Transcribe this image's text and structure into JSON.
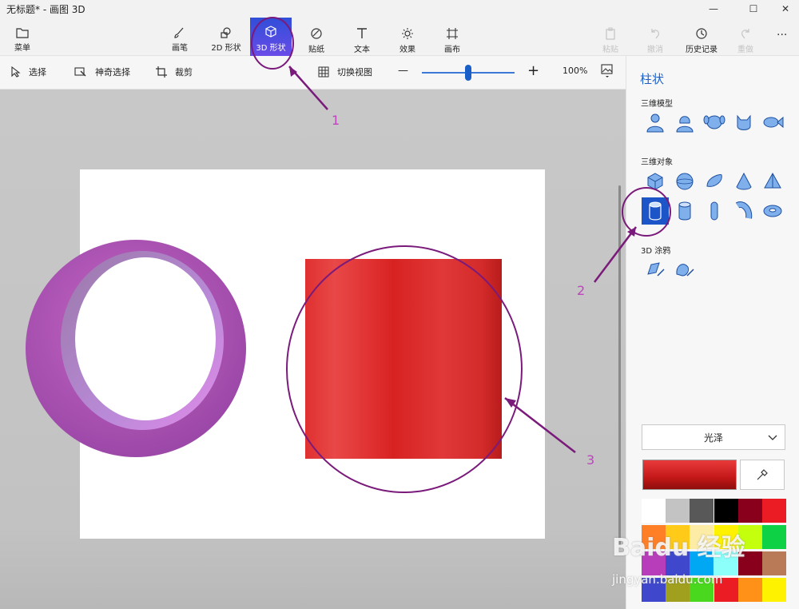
{
  "window": {
    "title": "无标题* - 画图 3D",
    "controls": [
      "—",
      "☐",
      "✕"
    ]
  },
  "ribbon": {
    "menu": "菜单",
    "tools": [
      {
        "label": "画笔",
        "icon": "brush-icon"
      },
      {
        "label": "2D 形状",
        "icon": "shapes-2d-icon"
      },
      {
        "label": "3D 形状",
        "icon": "cube-icon"
      },
      {
        "label": "贴纸",
        "icon": "sticker-icon"
      },
      {
        "label": "文本",
        "icon": "text-icon"
      },
      {
        "label": "效果",
        "icon": "effects-icon"
      },
      {
        "label": "画布",
        "icon": "canvas-icon"
      }
    ],
    "active_tool": "3D 形状",
    "right_actions": [
      {
        "label": "粘贴",
        "icon": "paste-icon",
        "enabled": false
      },
      {
        "label": "撤消",
        "icon": "undo-icon",
        "enabled": false
      },
      {
        "label": "历史记录",
        "icon": "history-icon",
        "enabled": true
      },
      {
        "label": "重做",
        "icon": "redo-icon",
        "enabled": false
      }
    ],
    "more": "···"
  },
  "subtoolbar": {
    "select": "选择",
    "magic_select": "神奇选择",
    "crop": "裁剪",
    "toggle_view": "切换视图",
    "zoom_minus": "—",
    "zoom_plus": "+",
    "zoom_level": "100%",
    "zoom_fraction": 0.5
  },
  "panel": {
    "title": "柱状",
    "section_models": "三维模型",
    "models": [
      "man-model-icon",
      "woman-model-icon",
      "dog-model-icon",
      "cat-model-icon",
      "fish-model-icon"
    ],
    "section_objects": "三维对象",
    "objects": [
      "cube-icon",
      "sphere-icon",
      "hemisphere-icon",
      "cone-icon",
      "pyramid-icon",
      "cylinder-icon",
      "tube-icon",
      "capsule-icon",
      "curved-tube-icon",
      "torus-icon"
    ],
    "selected_object": "cylinder-icon",
    "section_doodle": "3D 涂鸦",
    "doodles": [
      "sharp-doodle-icon",
      "soft-doodle-icon"
    ],
    "finish": "光泽",
    "current_color": "#d42020",
    "palette": [
      "#ffffff",
      "#c3c3c3",
      "#585858",
      "#000000",
      "#88001b",
      "#ec1c24",
      "#ff7f27",
      "#ffca18",
      "#fdeca6",
      "#fff200",
      "#c4ff0e",
      "#0ed145",
      "#b83dba",
      "#3f48cc",
      "#00a8f3",
      "#8cfffb",
      "#88001b",
      "#b97a57",
      "#3f48cc",
      "#a0a01e",
      "#4ad81e",
      "#ec1c24",
      "#ff9018",
      "#fff200"
    ]
  },
  "annotations": [
    "1",
    "2",
    "3"
  ],
  "watermark": {
    "main": "Baidu 经验",
    "sub": "jingyan.baidu.com"
  }
}
